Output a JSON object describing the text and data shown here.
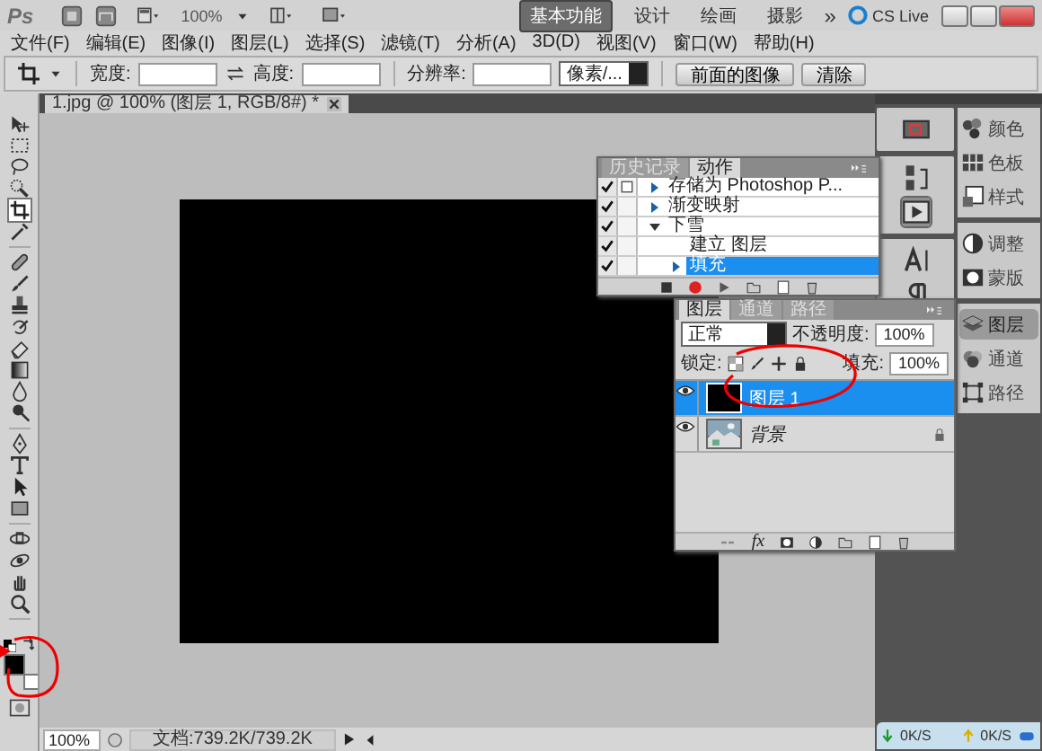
{
  "app_bar": {
    "logo": "Ps",
    "zoom": "100%",
    "workspaces": [
      {
        "label": "基本功能",
        "selected": true
      },
      {
        "label": "设计",
        "selected": false
      },
      {
        "label": "绘画",
        "selected": false
      },
      {
        "label": "摄影",
        "selected": false
      }
    ],
    "more": "»",
    "cs_live": "CS Live"
  },
  "menu": [
    "文件(F)",
    "编辑(E)",
    "图像(I)",
    "图层(L)",
    "选择(S)",
    "滤镜(T)",
    "分析(A)",
    "3D(D)",
    "视图(V)",
    "窗口(W)",
    "帮助(H)"
  ],
  "options": {
    "width_label": "宽度:",
    "height_label": "高度:",
    "resolution_label": "分辨率:",
    "unit": "像素/...",
    "front_image": "前面的图像",
    "clear": "清除"
  },
  "document_tab": {
    "title": "1.jpg @ 100% (图层 1, RGB/8#) *"
  },
  "tool_groups": [
    [
      {
        "kind": "move",
        "selected": false
      },
      {
        "kind": "marquee",
        "selected": false
      },
      {
        "kind": "lasso",
        "selected": false
      },
      {
        "kind": "quick_select",
        "selected": false
      },
      {
        "kind": "crop",
        "selected": true
      },
      {
        "kind": "eyedropper",
        "selected": false
      }
    ],
    [
      {
        "kind": "healing",
        "selected": false
      },
      {
        "kind": "brush",
        "selected": false
      },
      {
        "kind": "stamp",
        "selected": false
      },
      {
        "kind": "history_brush",
        "selected": false
      },
      {
        "kind": "eraser",
        "selected": false
      },
      {
        "kind": "gradient",
        "selected": false
      },
      {
        "kind": "blur",
        "selected": false
      },
      {
        "kind": "dodge",
        "selected": false
      }
    ],
    [
      {
        "kind": "pen",
        "selected": false
      },
      {
        "kind": "type",
        "selected": false
      },
      {
        "kind": "path_select",
        "selected": false
      },
      {
        "kind": "shape",
        "selected": false
      }
    ],
    [
      {
        "kind": "rotate3d",
        "selected": false
      },
      {
        "kind": "orbit3d",
        "selected": false
      },
      {
        "kind": "hand",
        "selected": false
      },
      {
        "kind": "zoom",
        "selected": false
      }
    ]
  ],
  "status_bar": {
    "zoom": "100%",
    "doc_info": "文档:739.2K/739.2K"
  },
  "dock_icons": [
    [
      {
        "kind": "navigator",
        "selected": false
      }
    ],
    [
      {
        "kind": "history",
        "selected": false
      },
      {
        "kind": "actions",
        "selected": true
      }
    ],
    [
      {
        "kind": "character",
        "selected": false
      },
      {
        "kind": "paragraph",
        "selected": false
      }
    ]
  ],
  "dock_panels": [
    [
      {
        "label": "颜色",
        "kind": "color",
        "selected": false
      },
      {
        "label": "色板",
        "kind": "swatches",
        "selected": false
      },
      {
        "label": "样式",
        "kind": "styles",
        "selected": false
      }
    ],
    [
      {
        "label": "调整",
        "kind": "adjustments",
        "selected": false
      },
      {
        "label": "蒙版",
        "kind": "masks",
        "selected": false
      }
    ],
    [
      {
        "label": "图层",
        "kind": "layers",
        "selected": true
      },
      {
        "label": "通道",
        "kind": "channels",
        "selected": false
      },
      {
        "label": "路径",
        "kind": "paths",
        "selected": false
      }
    ]
  ],
  "history_panel": {
    "tabs": [
      {
        "label": "历史记录",
        "selected": false
      },
      {
        "label": "动作",
        "selected": true
      }
    ],
    "actions": [
      {
        "label": "存储为 Photoshop P...",
        "kind": "expandable",
        "expanded": false,
        "checked": true,
        "dialog": true,
        "selected": false
      },
      {
        "label": "渐变映射",
        "kind": "expandable",
        "expanded": false,
        "checked": true,
        "dialog": false,
        "selected": false
      },
      {
        "label": "下雪",
        "kind": "expandable",
        "expanded": true,
        "checked": true,
        "dialog": false,
        "selected": false,
        "children": [
          {
            "label": "建立 图层",
            "kind": "plain",
            "checked": true,
            "dialog": false,
            "selected": false
          },
          {
            "label": "填充",
            "kind": "expandable",
            "expanded": false,
            "checked": true,
            "dialog": false,
            "selected": true
          }
        ]
      }
    ]
  },
  "layers_panel": {
    "tabs": [
      {
        "label": "图层",
        "selected": true
      },
      {
        "label": "通道",
        "selected": false
      },
      {
        "label": "路径",
        "selected": false
      }
    ],
    "blend_mode": "正常",
    "opacity_label": "不透明度:",
    "opacity": "100%",
    "lock_label": "锁定:",
    "fill_label": "填充:",
    "fill": "100%",
    "fx": "fx",
    "layers": [
      {
        "name": "图层 1",
        "kind": "fill",
        "visible": true,
        "selected": true,
        "locked": false
      },
      {
        "name": "背景",
        "visible": true,
        "selected": false,
        "locked": true
      }
    ]
  },
  "network": {
    "down": "0K/S",
    "up": "0K/S"
  }
}
